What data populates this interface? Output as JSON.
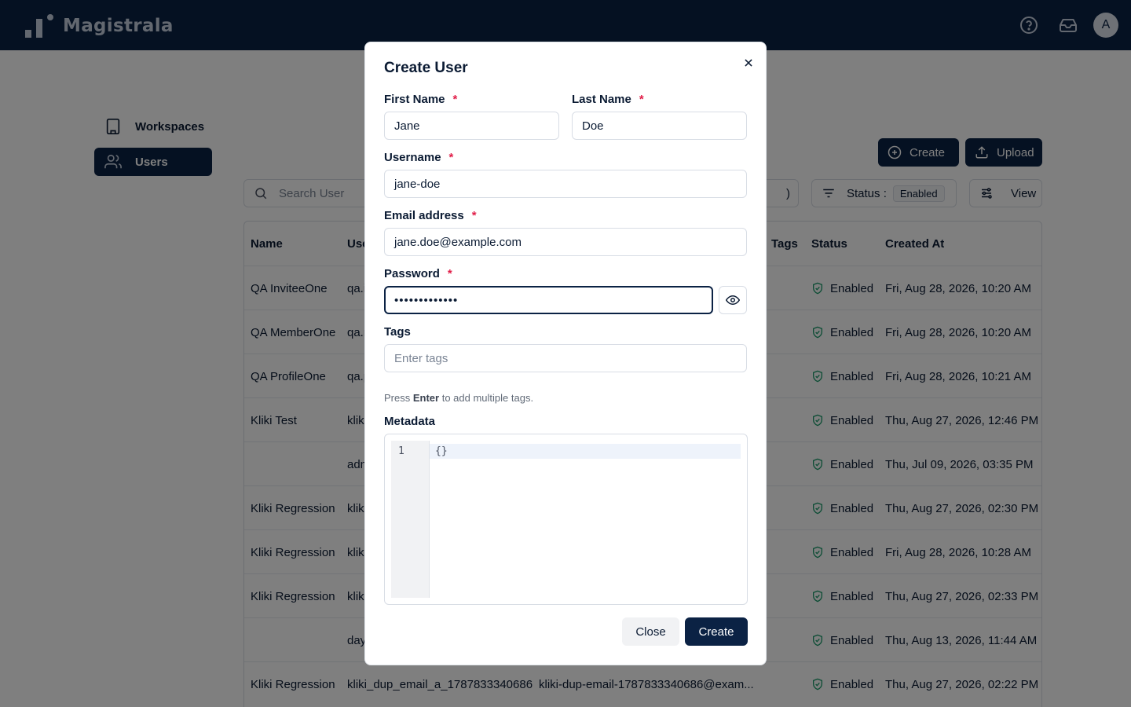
{
  "app": {
    "name": "Magistrala",
    "avatar_initial": "A"
  },
  "icons": {
    "help": "help-circle-icon",
    "inbox": "inbox-icon",
    "workspaces": "building-icon",
    "users": "users-icon",
    "search": "search-icon",
    "filter": "filter-icon",
    "view": "sliders-icon",
    "create": "plus-circle-icon",
    "upload": "upload-icon",
    "status": "shield-check-icon",
    "close": "close-icon",
    "eye": "eye-icon"
  },
  "colors": {
    "brand": "#0b2244",
    "required": "#e11d48",
    "status_ok": "#1a9a6a"
  },
  "sidebar": {
    "items": [
      {
        "label": "Workspaces",
        "active": false
      },
      {
        "label": "Users",
        "active": true
      }
    ]
  },
  "toolbar": {
    "create_label": "Create",
    "upload_label": "Upload",
    "search_placeholder": "Search User",
    "partial_select_suffix": ")",
    "status_filter_label": "Status :",
    "status_filter_value": "Enabled",
    "view_label": "View"
  },
  "table": {
    "headers": [
      "Name",
      "Use",
      "Tags",
      "Status",
      "Created At"
    ],
    "rows": [
      {
        "name": "QA InviteeOne",
        "username": "qa.i",
        "email": "",
        "status": "Enabled",
        "created": "Fri, Aug 28, 2026, 10:20 AM"
      },
      {
        "name": "QA MemberOne",
        "username": "qa.r",
        "email": "",
        "status": "Enabled",
        "created": "Fri, Aug 28, 2026, 10:20 AM"
      },
      {
        "name": "QA ProfileOne",
        "username": "qa.p",
        "email": "",
        "status": "Enabled",
        "created": "Fri, Aug 28, 2026, 10:21 AM"
      },
      {
        "name": "Kliki Test",
        "username": "klik",
        "email": "",
        "status": "Enabled",
        "created": "Thu, Aug 27, 2026, 12:46 PM"
      },
      {
        "name": "",
        "username": "adm",
        "email": "",
        "status": "Enabled",
        "created": "Thu, Jul 09, 2026, 03:35 PM"
      },
      {
        "name": "Kliki Regression",
        "username": "klik",
        "email": "",
        "status": "Enabled",
        "created": "Thu, Aug 27, 2026, 02:30 PM"
      },
      {
        "name": "Kliki Regression",
        "username": "klik",
        "email": "",
        "status": "Enabled",
        "created": "Fri, Aug 28, 2026, 10:28 AM"
      },
      {
        "name": "Kliki Regression",
        "username": "klik",
        "email": "",
        "status": "Enabled",
        "created": "Thu, Aug 27, 2026, 02:33 PM"
      },
      {
        "name": "",
        "username": "day",
        "email": "",
        "status": "Enabled",
        "created": "Thu, Aug 13, 2026, 11:44 AM"
      },
      {
        "name": "Kliki Regression",
        "username": "kliki_dup_email_a_1787833340686",
        "email": "kliki-dup-email-1787833340686@exam...",
        "status": "Enabled",
        "created": "Thu, Aug 27, 2026, 02:22 PM"
      }
    ]
  },
  "modal": {
    "title": "Create User",
    "required_mark": "*",
    "first_name": {
      "label": "First Name",
      "value": "Jane"
    },
    "last_name": {
      "label": "Last Name",
      "value": "Doe"
    },
    "username": {
      "label": "Username",
      "value": "jane-doe"
    },
    "email": {
      "label": "Email address",
      "value": "jane.doe@example.com"
    },
    "password": {
      "label": "Password",
      "masked_value": "•••••••••••••"
    },
    "tags": {
      "label": "Tags",
      "placeholder": "Enter tags"
    },
    "tags_hint": {
      "pre": "Press",
      "key": "Enter",
      "post": "to add multiple tags."
    },
    "metadata": {
      "label": "Metadata",
      "line_number": "1",
      "code": "{}"
    },
    "close_label": "Close",
    "create_label": "Create"
  }
}
